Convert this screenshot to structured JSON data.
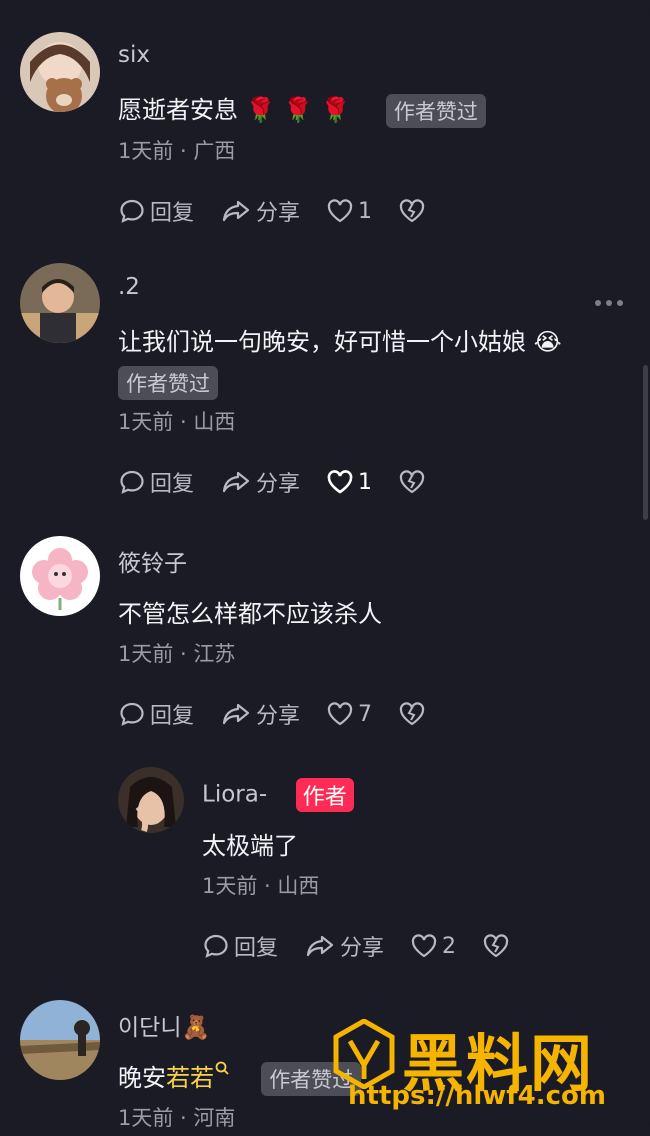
{
  "comments": [
    {
      "user": "six",
      "text": "愿逝者安息 🌹 🌹 🌹",
      "liked_by_author_tag": "作者赞过",
      "meta": "1天前 · 广西",
      "reply_label": "回复",
      "share_label": "分享",
      "likes": "1"
    },
    {
      "user": ".2",
      "text": "让我们说一句晚安，好可惜一个小姑娘 😭",
      "liked_by_author_tag": "作者赞过",
      "meta": "1天前 · 山西",
      "reply_label": "回复",
      "share_label": "分享",
      "likes": "1"
    },
    {
      "user": "筱铃子",
      "text": "不管怎么样都不应该杀人",
      "meta": "1天前 · 江苏",
      "reply_label": "回复",
      "share_label": "分享",
      "likes": "7"
    },
    {
      "user": "Liora-",
      "author_tag": "作者",
      "text": "太极端了",
      "meta": "1天前 · 山西",
      "reply_label": "回复",
      "share_label": "分享",
      "likes": "2"
    },
    {
      "user": "이단니🧸",
      "text_prefix": "晚安",
      "text_highlight": "若若",
      "liked_by_author_tag": "作者赞过",
      "meta": "1天前 · 河南"
    }
  ],
  "watermark": {
    "title": "黑料网",
    "url": "https://hlwf4.com"
  },
  "colors": {
    "background": "#1a1b24",
    "author_tag": "#fe2c55",
    "watermark": "#f5b400",
    "highlight": "#f7d24a"
  }
}
